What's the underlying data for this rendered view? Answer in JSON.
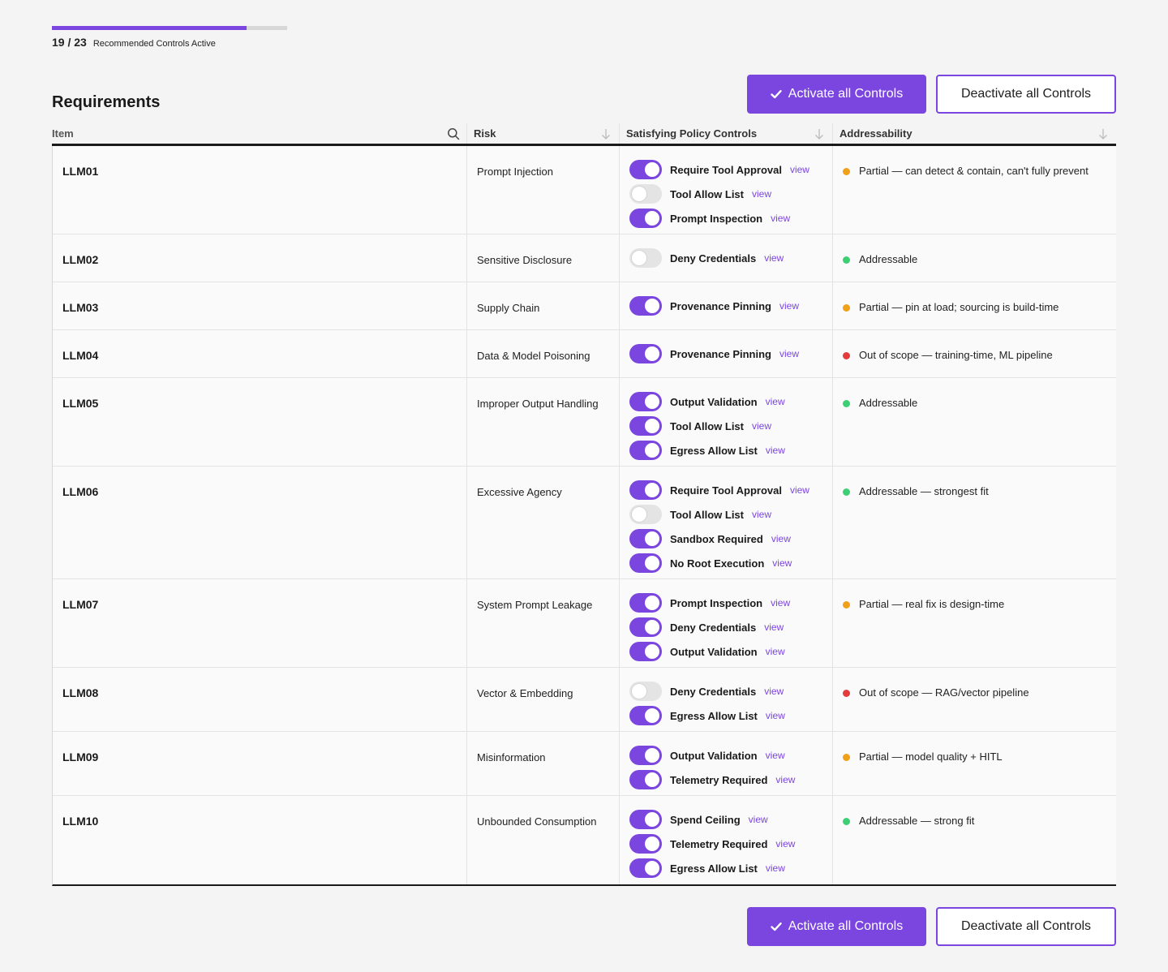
{
  "progress": {
    "active": 19,
    "total": 23,
    "count_text": "19 / 23",
    "label": "Recommended Controls Active",
    "fraction": 0.826
  },
  "section": {
    "title": "Requirements"
  },
  "actions": {
    "activate_label": "Activate all Controls",
    "deactivate_label": "Deactivate all Controls"
  },
  "columns": {
    "item": "Item",
    "risk": "Risk",
    "controls": "Satisfying Policy Controls",
    "addressability": "Addressability"
  },
  "control_link_label": "view",
  "status_colors": {
    "green": "#3ecf75",
    "orange": "#f0a01a",
    "red": "#e23d3d"
  },
  "icons": {
    "search": "search-icon",
    "sort": "sort-arrow-down-icon",
    "check": "check-icon"
  },
  "rows": [
    {
      "id": "LLM01",
      "risk": "Prompt Injection",
      "controls": [
        {
          "name": "Require Tool Approval",
          "on": true
        },
        {
          "name": "Tool Allow List",
          "on": false
        },
        {
          "name": "Prompt Inspection",
          "on": true
        }
      ],
      "status": "orange",
      "addressability": "Partial — can detect & contain, can't fully prevent"
    },
    {
      "id": "LLM02",
      "risk": "Sensitive Disclosure",
      "controls": [
        {
          "name": "Deny Credentials",
          "on": false
        }
      ],
      "status": "green",
      "addressability": "Addressable"
    },
    {
      "id": "LLM03",
      "risk": "Supply Chain",
      "controls": [
        {
          "name": "Provenance Pinning",
          "on": true
        }
      ],
      "status": "orange",
      "addressability": "Partial — pin at load; sourcing is build-time"
    },
    {
      "id": "LLM04",
      "risk": "Data & Model Poisoning",
      "controls": [
        {
          "name": "Provenance Pinning",
          "on": true
        }
      ],
      "status": "red",
      "addressability": "Out of scope — training-time, ML pipeline"
    },
    {
      "id": "LLM05",
      "risk": "Improper Output Handling",
      "controls": [
        {
          "name": "Output Validation",
          "on": true
        },
        {
          "name": "Tool Allow List",
          "on": true
        },
        {
          "name": "Egress Allow List",
          "on": true
        }
      ],
      "status": "green",
      "addressability": "Addressable"
    },
    {
      "id": "LLM06",
      "risk": "Excessive Agency",
      "controls": [
        {
          "name": "Require Tool Approval",
          "on": true
        },
        {
          "name": "Tool Allow List",
          "on": false
        },
        {
          "name": "Sandbox Required",
          "on": true
        },
        {
          "name": "No Root Execution",
          "on": true
        }
      ],
      "status": "green",
      "addressability": "Addressable — strongest fit"
    },
    {
      "id": "LLM07",
      "risk": "System Prompt Leakage",
      "controls": [
        {
          "name": "Prompt Inspection",
          "on": true
        },
        {
          "name": "Deny Credentials",
          "on": true
        },
        {
          "name": "Output Validation",
          "on": true
        }
      ],
      "status": "orange",
      "addressability": "Partial — real fix is design-time"
    },
    {
      "id": "LLM08",
      "risk": "Vector & Embedding",
      "controls": [
        {
          "name": "Deny Credentials",
          "on": false
        },
        {
          "name": "Egress Allow List",
          "on": true
        }
      ],
      "status": "red",
      "addressability": "Out of scope — RAG/vector pipeline"
    },
    {
      "id": "LLM09",
      "risk": "Misinformation",
      "controls": [
        {
          "name": "Output Validation",
          "on": true
        },
        {
          "name": "Telemetry Required",
          "on": true
        }
      ],
      "status": "orange",
      "addressability": "Partial — model quality + HITL"
    },
    {
      "id": "LLM10",
      "risk": "Unbounded Consumption",
      "controls": [
        {
          "name": "Spend Ceiling",
          "on": true
        },
        {
          "name": "Telemetry Required",
          "on": true
        },
        {
          "name": "Egress Allow List",
          "on": true
        }
      ],
      "status": "green",
      "addressability": "Addressable — strong fit"
    }
  ]
}
